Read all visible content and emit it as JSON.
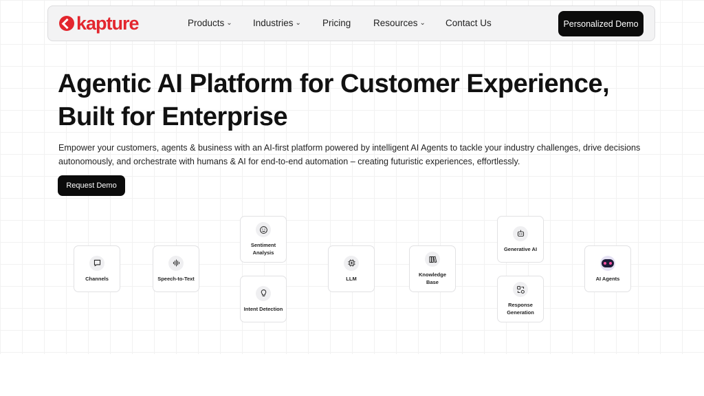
{
  "nav": {
    "logo": "kapture",
    "items": [
      {
        "label": "Products",
        "dropdown": true
      },
      {
        "label": "Industries",
        "dropdown": true
      },
      {
        "label": "Pricing",
        "dropdown": false
      },
      {
        "label": "Resources",
        "dropdown": true
      },
      {
        "label": "Contact Us",
        "dropdown": false
      }
    ],
    "cta": "Personalized Demo"
  },
  "hero": {
    "title_line1": "Agentic AI Platform for Customer Experience,",
    "title_line2": "Built for Enterprise",
    "subtitle": "Empower your customers, agents & business with an AI-first platform powered by intelligent AI Agents to tackle your industry challenges, drive decisions autonomously, and orchestrate with humans & AI for end-to-end automation – creating futuristic experiences, effortlessly.",
    "cta": "Request Demo"
  },
  "flow": {
    "channels": {
      "label": "Channels",
      "icon": "chat-icon"
    },
    "speech": {
      "label": "Speech-to-Text",
      "icon": "waveform-icon"
    },
    "sentiment": {
      "label": "Sentiment Analysis",
      "icon": "smile-icon"
    },
    "intent": {
      "label": "Intent Detection",
      "icon": "lightbulb-icon"
    },
    "llm": {
      "label": "LLM",
      "icon": "chip-icon"
    },
    "kb": {
      "label": "Knowledge Base",
      "icon": "books-icon"
    },
    "genai": {
      "label": "Generative AI",
      "icon": "robot-icon"
    },
    "response": {
      "label": "Response Generation",
      "icon": "transform-icon"
    },
    "agents": {
      "label": "AI Agents",
      "icon": "ai-bot-icon"
    }
  },
  "colors": {
    "brand": "#e3262e",
    "button": "#0b0b0b"
  }
}
